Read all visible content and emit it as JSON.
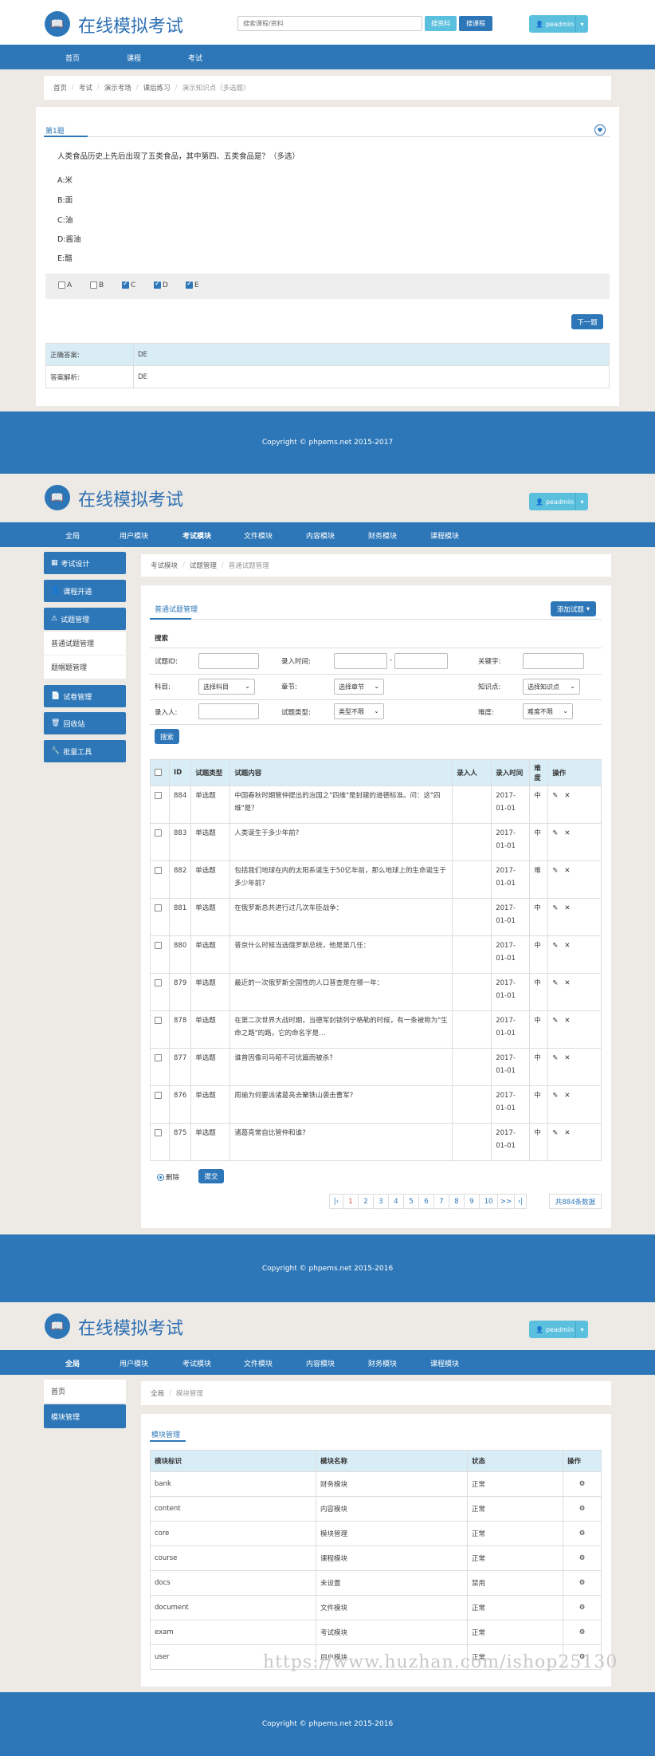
{
  "s1": {
    "brand": "在线模拟考试",
    "search_placeholder": "搜索课程/资料",
    "search_material_btn": "搜资料",
    "search_course_btn": "搜课程",
    "user": "peadmin",
    "nav": [
      "首页",
      "课程",
      "考试"
    ],
    "breadcrumb": [
      "首页",
      "考试",
      "演示考场",
      "课后练习",
      "演示知识点（多选题）"
    ],
    "question_no": "第1题",
    "question_text": "人类食品历史上先后出现了五类食品，其中第四、五类食品是？（多选）",
    "options": [
      "A:米",
      "B:面",
      "C:油",
      "D:酱油",
      "E:醋"
    ],
    "answers": [
      {
        "label": "A",
        "checked": false
      },
      {
        "label": "B",
        "checked": false
      },
      {
        "label": "C",
        "checked": true
      },
      {
        "label": "D",
        "checked": true
      },
      {
        "label": "E",
        "checked": true
      }
    ],
    "next_btn": "下一题",
    "correct_label": "正确答案:",
    "correct_value": "DE",
    "analysis_label": "答案解析:",
    "analysis_value": "DE",
    "footer": "Copyright © phpems.net 2015-2017"
  },
  "s2": {
    "brand": "在线模拟考试",
    "user": "peadmin",
    "nav": [
      "全局",
      "用户模块",
      "考试模块",
      "文件模块",
      "内容模块",
      "财务模块",
      "课程模块"
    ],
    "sidebar": [
      "考试设计",
      "课程开通",
      "试题管理",
      "试卷管理",
      "回收站",
      "批量工具"
    ],
    "sidebar_sub": [
      "普通试题管理",
      "题帽题管理"
    ],
    "breadcrumb": [
      "考试模块",
      "试题管理",
      "普通试题管理"
    ],
    "panel_title": "普通试题管理",
    "add_btn": "添加试题",
    "search_title": "搜索",
    "filters": {
      "id_label": "试题ID:",
      "time_label": "录入时间:",
      "keyword_label": "关键字:",
      "subject_label": "科目:",
      "subject_value": "选择科目",
      "chapter_label": "章节:",
      "chapter_value": "选择章节",
      "point_label": "知识点:",
      "point_value": "选择知识点",
      "author_label": "录入人:",
      "type_label": "试题类型:",
      "type_value": "类型不限",
      "difficulty_label": "难度:",
      "difficulty_value": "难度不限",
      "search_btn": "搜索"
    },
    "columns": [
      "ID",
      "试题类型",
      "试题内容",
      "录入人",
      "录入时间",
      "难度",
      "操作"
    ],
    "rows": [
      {
        "id": "884",
        "type": "单选题",
        "content": "中国春秋时期管仲提出的治国之\"四维\"是封建的道德标准。问：这\"四维\"是？",
        "author": "",
        "date": "2017-01-01",
        "difficulty": "中"
      },
      {
        "id": "883",
        "type": "单选题",
        "content": "人类诞生于多少年前?",
        "author": "",
        "date": "2017-01-01",
        "difficulty": "中"
      },
      {
        "id": "882",
        "type": "单选题",
        "content": "包括我们地球在内的太阳系诞生于50亿年前，那么地球上的生命诞生于多少年前?",
        "author": "",
        "date": "2017-01-01",
        "difficulty": "难"
      },
      {
        "id": "881",
        "type": "单选题",
        "content": "在俄罗斯总共进行过几次车臣战争：",
        "author": "",
        "date": "2017-01-01",
        "difficulty": "中"
      },
      {
        "id": "880",
        "type": "单选题",
        "content": "普京什么时候当选俄罗斯总统，他是第几任：",
        "author": "",
        "date": "2017-01-01",
        "difficulty": "中"
      },
      {
        "id": "879",
        "type": "单选题",
        "content": "最近的一次俄罗斯全国性的人口普查是在哪一年：",
        "author": "",
        "date": "2017-01-01",
        "difficulty": "中"
      },
      {
        "id": "878",
        "type": "单选题",
        "content": "在第二次世界大战时期，当德军封锁列宁格勒的时候，有一条被称为\"生命之路\"的路，它的命名字是…",
        "author": "",
        "date": "2017-01-01",
        "difficulty": "中"
      },
      {
        "id": "877",
        "type": "单选题",
        "content": "谁曾因像司马昭不可优篇而被杀?",
        "author": "",
        "date": "2017-01-01",
        "difficulty": "中"
      },
      {
        "id": "876",
        "type": "单选题",
        "content": "周瑜为何要派诸葛亮去聚铁山袭击曹军?",
        "author": "",
        "date": "2017-01-01",
        "difficulty": "中"
      },
      {
        "id": "875",
        "type": "单选题",
        "content": "诸葛亮常自比管仲和谁?",
        "author": "",
        "date": "2017-01-01",
        "difficulty": "中"
      }
    ],
    "delete_label": "删除",
    "submit_btn": "提交",
    "pages": [
      "|‹",
      "1",
      "2",
      "3",
      "4",
      "5",
      "6",
      "7",
      "8",
      "9",
      "10",
      ">>",
      "›|"
    ],
    "total": "共884条数据",
    "footer": "Copyright © phpems.net 2015-2016"
  },
  "s3": {
    "brand": "在线模拟考试",
    "user": "peadmin",
    "nav": [
      "全局",
      "用户模块",
      "考试模块",
      "文件模块",
      "内容模块",
      "财务模块",
      "课程模块"
    ],
    "sidebar": [
      "首页",
      "模块管理"
    ],
    "breadcrumb": [
      "全局",
      "模块管理"
    ],
    "panel_title": "模块管理",
    "columns": [
      "模块标识",
      "模块名称",
      "状态",
      "操作"
    ],
    "rows": [
      {
        "key": "bank",
        "name": "财务模块",
        "status": "正常"
      },
      {
        "key": "content",
        "name": "内容模块",
        "status": "正常"
      },
      {
        "key": "core",
        "name": "模块管理",
        "status": "正常"
      },
      {
        "key": "course",
        "name": "课程模块",
        "status": "正常"
      },
      {
        "key": "docs",
        "name": "未设置",
        "status": "禁用"
      },
      {
        "key": "document",
        "name": "文件模块",
        "status": "正常"
      },
      {
        "key": "exam",
        "name": "考试模块",
        "status": "正常"
      },
      {
        "key": "user",
        "name": "用户模块",
        "status": "正常"
      }
    ],
    "footer": "Copyright © phpems.net 2015-2016",
    "watermark": "https://www.huzhan.com/ishop25130"
  },
  "colors": {
    "primary": "#2d77b8",
    "info": "#5bc0de",
    "table_head": "#d9edf7",
    "background": "#ede9e4"
  }
}
